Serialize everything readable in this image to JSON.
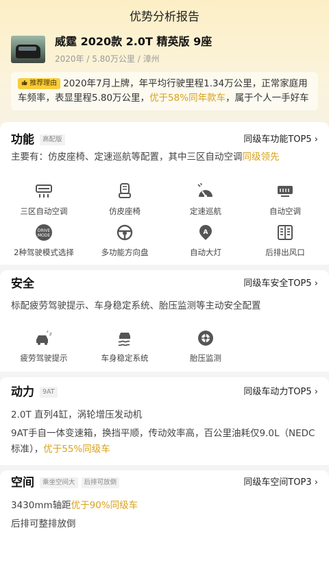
{
  "page": {
    "title": "优势分析报告"
  },
  "car": {
    "name": "威霆 2020款 2.0T 精英版 9座",
    "meta": "2020年 / 5.80万公里 / 漳州"
  },
  "reason": {
    "tag": "推荐理由",
    "text_a": "2020年7月上牌，年平均行驶里程1.34万公里，正常家庭用车频率，表显里程5.80万公里，",
    "highlight": "优于58%同年款车",
    "text_b": "，属于个人一手好车"
  },
  "function": {
    "title": "功能",
    "tag": "高配版",
    "link": "同级车功能TOP5",
    "desc_a": "主要有：仿皮座椅、定速巡航等配置，其中三区自动空调",
    "desc_hl": "同级领先",
    "features": [
      {
        "label": "三区自动空调",
        "icon": "ac-vent-icon"
      },
      {
        "label": "仿皮座椅",
        "icon": "seat-icon"
      },
      {
        "label": "定速巡航",
        "icon": "cruise-control-icon"
      },
      {
        "label": "自动空调",
        "icon": "auto-ac-icon"
      },
      {
        "label": "2种驾驶模式选择",
        "icon": "drive-mode-icon"
      },
      {
        "label": "多功能方向盘",
        "icon": "steering-wheel-icon"
      },
      {
        "label": "自动大灯",
        "icon": "auto-headlight-icon"
      },
      {
        "label": "后排出风口",
        "icon": "rear-vent-icon"
      }
    ]
  },
  "safety": {
    "title": "安全",
    "link": "同级车安全TOP5",
    "desc": "标配疲劳驾驶提示、车身稳定系统、胎压监测等主动安全配置",
    "features": [
      {
        "label": "疲劳驾驶提示",
        "icon": "fatigue-alert-icon"
      },
      {
        "label": "车身稳定系统",
        "icon": "stability-control-icon"
      },
      {
        "label": "胎压监测",
        "icon": "tire-pressure-icon"
      }
    ]
  },
  "power": {
    "title": "动力",
    "tag": "9AT",
    "link": "同级车动力TOP5",
    "line1": "2.0T 直列4缸，涡轮增压发动机",
    "line2": "9AT手自一体变速箱，换挡平顺，传动效率高，百公里油耗仅9.0L（NEDC标准），",
    "line2_hl": "优于55%同级车"
  },
  "space": {
    "title": "空间",
    "tag1": "乘坐空间大",
    "tag2": "后排可放倒",
    "link": "同级车空间TOP3",
    "line1_a": "3430mm轴距",
    "line1_hl": "优于90%同级车",
    "line2": "后排可整排放倒"
  },
  "colors": {
    "accent": "#d9a11a",
    "tag_yellow": "#f9cd3b",
    "icon": "#555555"
  }
}
